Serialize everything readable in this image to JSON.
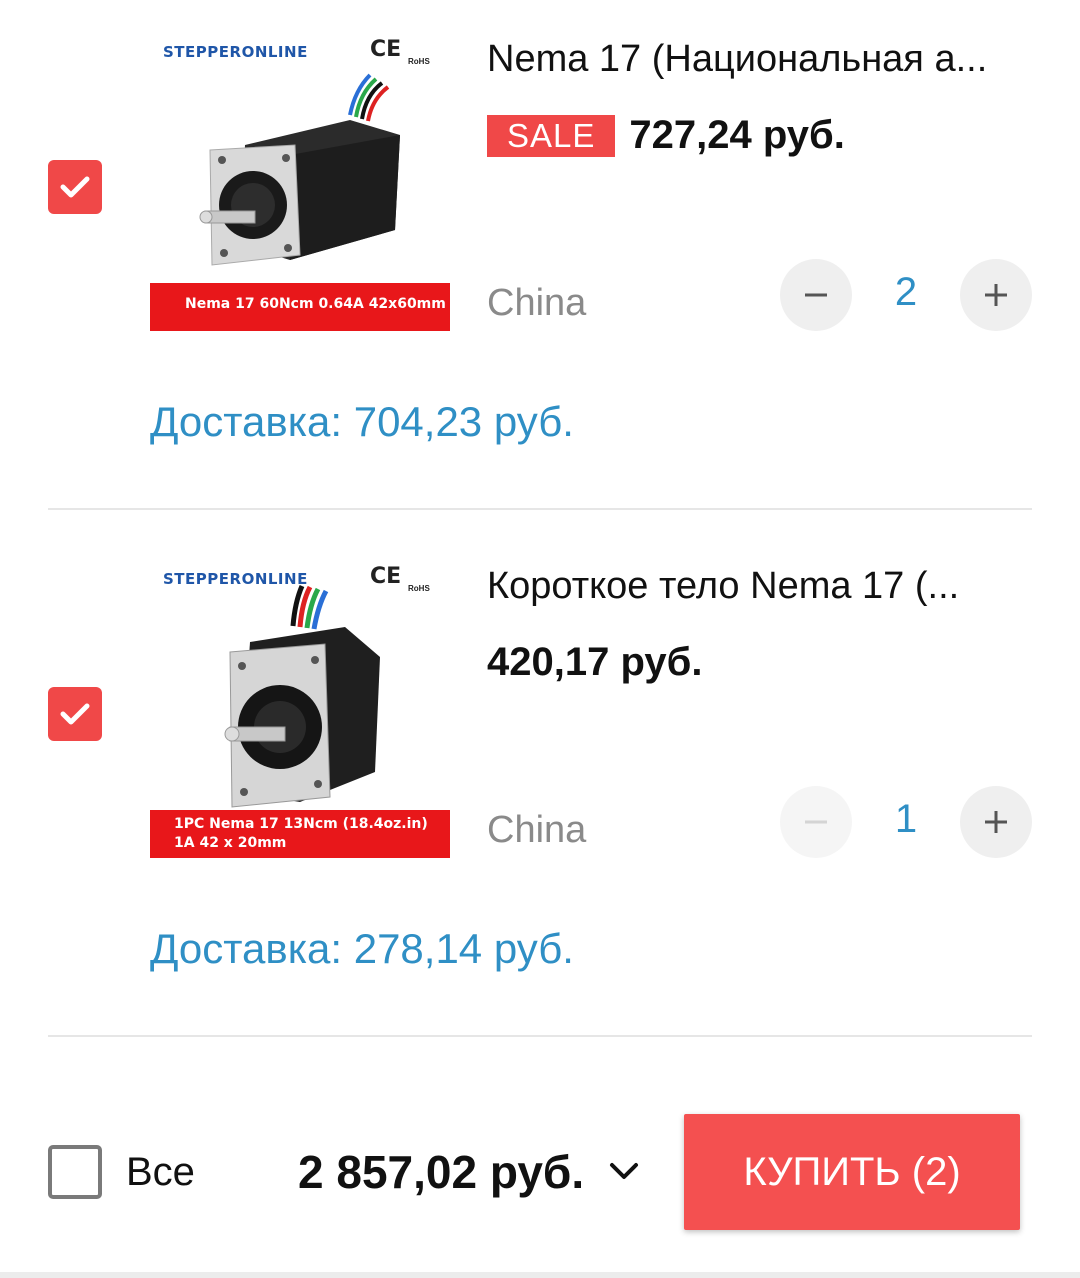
{
  "colors": {
    "accent_red": "#f04848",
    "link_blue": "#2f8fc5",
    "muted_gray": "#8a8a8a",
    "buy_button": "#f45050"
  },
  "items": [
    {
      "selected": true,
      "image": {
        "brand": "STEPPERONLINE",
        "ce": "CE",
        "rohs": "RoHS",
        "banner": "Nema 17 60Ncm 0.64A 42x60mm"
      },
      "title": "Nema 17 (Национальная а...",
      "sale_badge": "SALE",
      "price": "727,24 руб.",
      "origin": "China",
      "quantity": "2",
      "shipping": "Доставка: 704,23 руб.",
      "icons": {
        "check": "checkmark-icon",
        "minus": "minus-icon",
        "plus": "plus-icon"
      }
    },
    {
      "selected": true,
      "image": {
        "brand": "STEPPERONLINE",
        "ce": "CE",
        "rohs": "RoHS",
        "banner_line1": "1PC  Nema 17  13Ncm (18.4oz.in)",
        "banner_line2": "1A   42 x 20mm"
      },
      "title": "Короткое тело Nema 17 (...",
      "price": "420,17 руб.",
      "origin": "China",
      "quantity": "1",
      "shipping": "Доставка: 278,14 руб.",
      "icons": {
        "check": "checkmark-icon",
        "minus": "minus-icon",
        "plus": "plus-icon"
      }
    }
  ],
  "footer": {
    "select_all_label": "Все",
    "select_all_checked": false,
    "total": "2 857,02 руб.",
    "buy_label": "КУПИТЬ (2)",
    "chevron_icon": "chevron-down-icon"
  }
}
